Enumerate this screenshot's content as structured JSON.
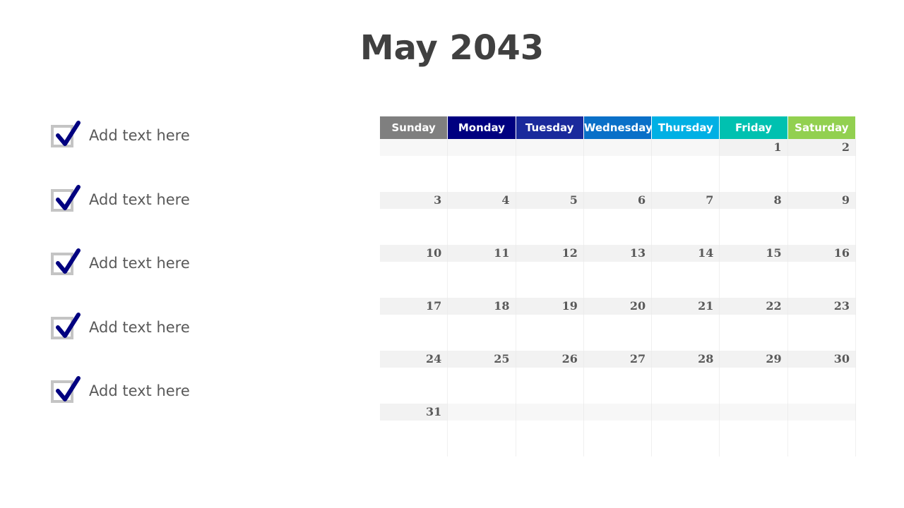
{
  "title": "May 2043",
  "checklist": [
    {
      "label": "Add text here",
      "checked": true
    },
    {
      "label": "Add text here",
      "checked": true
    },
    {
      "label": "Add text here",
      "checked": true
    },
    {
      "label": "Add text here",
      "checked": true
    },
    {
      "label": "Add text here",
      "checked": true
    }
  ],
  "calendar": {
    "days": [
      {
        "label": "Sunday",
        "color": "#7f7f7f"
      },
      {
        "label": "Monday",
        "color": "#000080"
      },
      {
        "label": "Tuesday",
        "color": "#1a2a9c"
      },
      {
        "label": "Wednesday",
        "color": "#0a70c8"
      },
      {
        "label": "Thursday",
        "color": "#00b0e4"
      },
      {
        "label": "Friday",
        "color": "#00c1b0"
      },
      {
        "label": "Saturday",
        "color": "#92d050"
      }
    ],
    "weeks": [
      [
        "",
        "",
        "",
        "",
        "",
        "1",
        "2"
      ],
      [
        "3",
        "4",
        "5",
        "6",
        "7",
        "8",
        "9"
      ],
      [
        "10",
        "11",
        "12",
        "13",
        "14",
        "15",
        "16"
      ],
      [
        "17",
        "18",
        "19",
        "20",
        "21",
        "22",
        "23"
      ],
      [
        "24",
        "25",
        "26",
        "27",
        "28",
        "29",
        "30"
      ],
      [
        "31",
        "",
        "",
        "",
        "",
        "",
        ""
      ]
    ]
  },
  "colors": {
    "check_mark": "#000080",
    "check_box": "#c4c4c4",
    "title": "#404040"
  }
}
